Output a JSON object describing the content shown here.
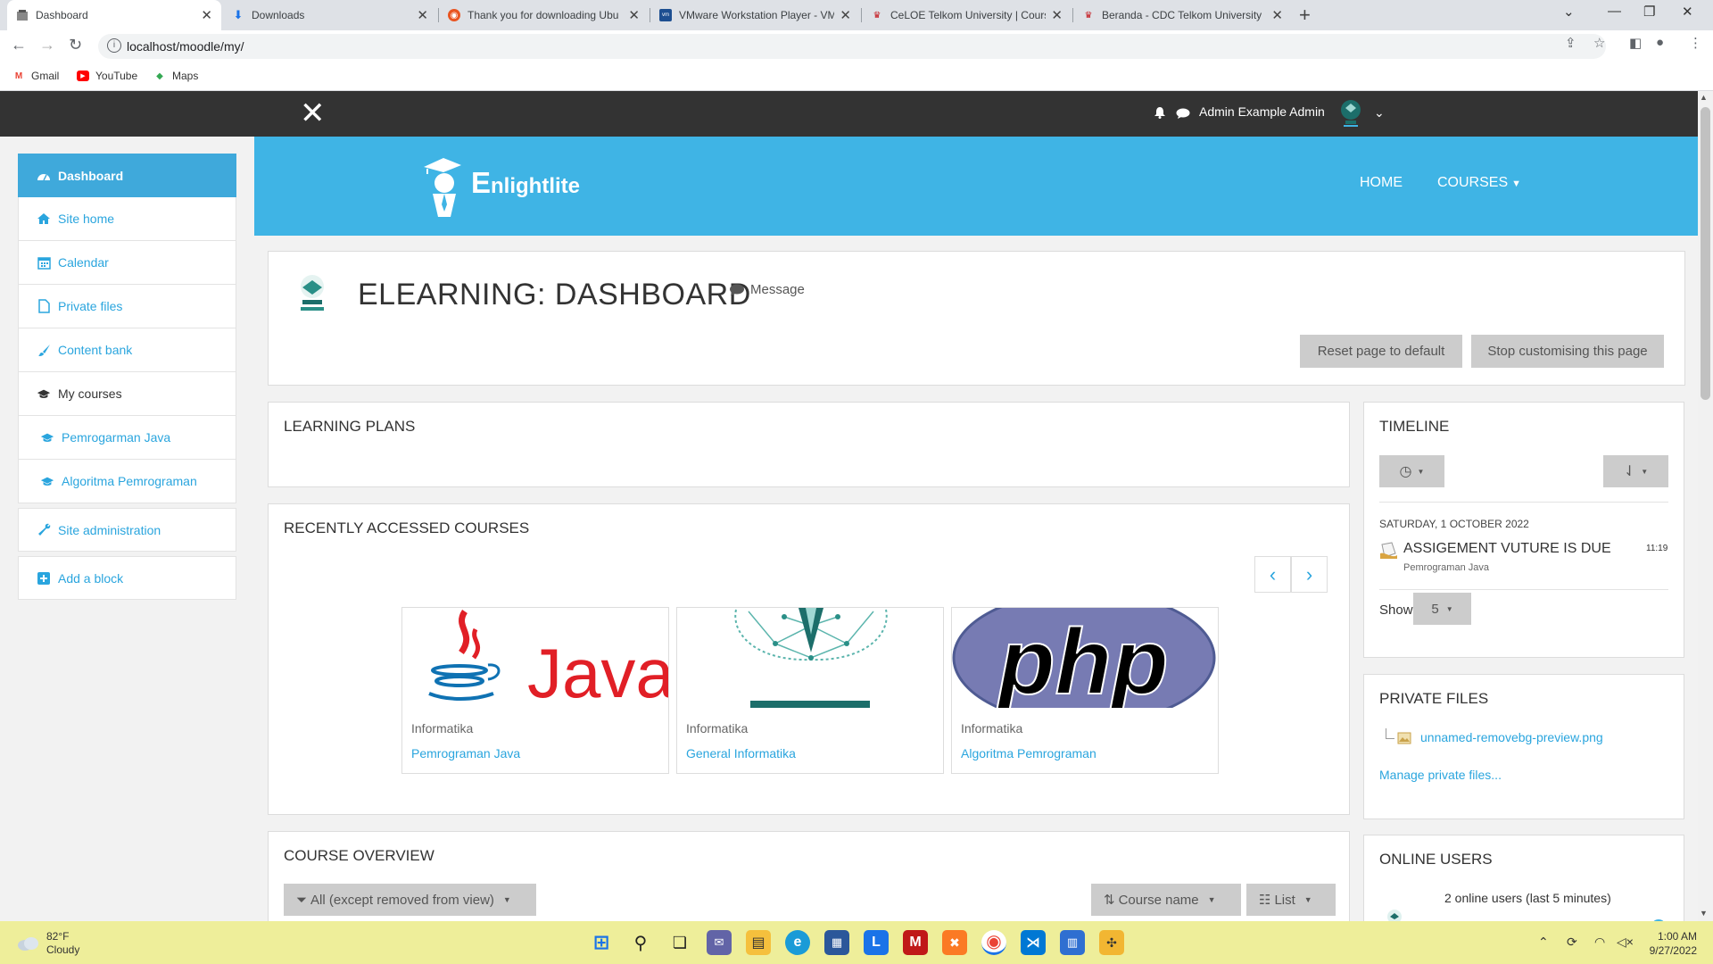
{
  "browser": {
    "tabs": [
      {
        "title": "Dashboard",
        "icon": "moodle-icon",
        "active": true
      },
      {
        "title": "Downloads",
        "icon": "download-icon"
      },
      {
        "title": "Thank you for downloading Ubu",
        "icon": "ubuntu-icon"
      },
      {
        "title": "VMware Workstation Player - VM",
        "icon": "vmware-icon"
      },
      {
        "title": "CeLOE Telkom University | Cours",
        "icon": "telkom-icon"
      },
      {
        "title": "Beranda - CDC Telkom University",
        "icon": "telkom-icon"
      }
    ],
    "url": "localhost/moodle/my/",
    "bookmarks": [
      {
        "label": "Gmail",
        "icon": "gmail-icon"
      },
      {
        "label": "YouTube",
        "icon": "youtube-icon"
      },
      {
        "label": "Maps",
        "icon": "maps-icon"
      }
    ]
  },
  "topbar": {
    "user_name": "Admin Example Admin"
  },
  "sidebar": {
    "items": [
      {
        "label": "Dashboard",
        "icon": "dashboard-icon"
      },
      {
        "label": "Site home",
        "icon": "home-icon"
      },
      {
        "label": "Calendar",
        "icon": "calendar-icon"
      },
      {
        "label": "Private files",
        "icon": "file-icon"
      },
      {
        "label": "Content bank",
        "icon": "brush-icon"
      },
      {
        "label": "My courses",
        "icon": "graduation-cap-icon"
      },
      {
        "label": "Pemrogarman Java",
        "icon": "graduation-cap-icon"
      },
      {
        "label": "Algoritma Pemrograman",
        "icon": "graduation-cap-icon"
      },
      {
        "label": "Site administration",
        "icon": "wrench-icon"
      },
      {
        "label": "Add a block",
        "icon": "plus-square-icon"
      }
    ]
  },
  "header": {
    "logo_first": "E",
    "logo_rest": "nlightlite",
    "nav_home": "HOME",
    "nav_courses": "COURSES"
  },
  "page": {
    "title": "ELEARNING: DASHBOARD",
    "message_link": "Message",
    "reset_button": "Reset page to default",
    "stop_button": "Stop customising this page"
  },
  "learning_plans": {
    "title": "LEARNING PLANS"
  },
  "recent_courses": {
    "title": "RECENTLY ACCESSED COURSES",
    "courses": [
      {
        "category": "Informatika",
        "name": "Pemrograman Java",
        "image": "java-logo"
      },
      {
        "category": "Informatika",
        "name": "General Informatika",
        "image": "prodi-logo"
      },
      {
        "category": "Informatika",
        "name": "Algoritma Pemrograman",
        "image": "php-logo"
      }
    ]
  },
  "course_overview": {
    "title": "COURSE OVERVIEW",
    "filter": "All (except removed from view)",
    "sort": "Course name",
    "view": "List"
  },
  "timeline": {
    "title": "TIMELINE",
    "date": "SATURDAY, 1 OCTOBER 2022",
    "event": "ASSIGEMENT VUTURE IS DUE",
    "event_course": "Pemrograman Java",
    "event_time": "11:19",
    "show_label": "Show",
    "show_value": "5"
  },
  "private_files": {
    "title": "PRIVATE FILES",
    "file": "unnamed-removebg-preview.png",
    "manage": "Manage private files..."
  },
  "online_users": {
    "title": "ONLINE USERS",
    "count_text": "2 online users (last 5 minutes)"
  },
  "taskbar": {
    "temp": "82°F",
    "weather": "Cloudy",
    "time": "1:00 AM",
    "date": "9/27/2022"
  },
  "colors": {
    "accent": "#3fb4e5",
    "link": "#2aa5de",
    "topbar": "#333333"
  }
}
